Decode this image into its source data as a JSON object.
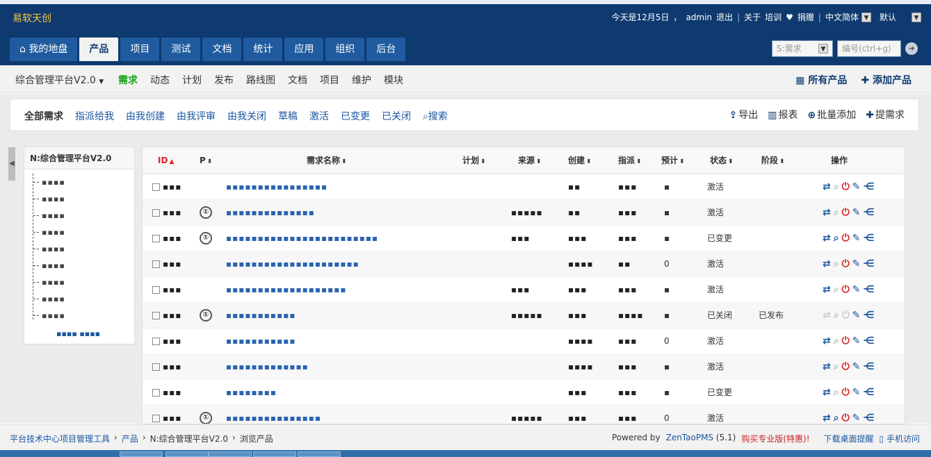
{
  "app": {
    "brand": "易软天创"
  },
  "topbar": {
    "date": "今天是12月5日",
    "user": "admin",
    "logout": "退出",
    "about": "关于",
    "training": "培训",
    "donate": "捐赠",
    "language": "中文简体",
    "theme": "默认"
  },
  "mainnav": [
    "我的地盘",
    "产品",
    "项目",
    "测试",
    "文档",
    "统计",
    "应用",
    "组织",
    "后台"
  ],
  "search": {
    "type": "S:需求",
    "placeholder": "编号(ctrl+g)"
  },
  "subnav": {
    "product": "综合管理平台V2.0",
    "items": [
      "需求",
      "动态",
      "计划",
      "发布",
      "路线图",
      "文档",
      "项目",
      "维护",
      "模块"
    ],
    "all_products": "所有产品",
    "add_product": "添加产品"
  },
  "featurebar": {
    "tabs": [
      "全部需求",
      "指派给我",
      "由我创建",
      "由我评审",
      "由我关闭",
      "草稿",
      "激活",
      "已变更",
      "已关闭",
      "搜索"
    ],
    "export": "导出",
    "report": "报表",
    "batch_add": "批量添加",
    "create": "提需求"
  },
  "tree": {
    "title": "N:综合管理平台V2.0",
    "nodes": [
      "▪▪▪▪",
      "▪▪▪▪",
      "▪▪▪▪",
      "▪▪▪▪",
      "▪▪▪▪",
      "▪▪▪▪",
      "▪▪▪▪",
      "▪▪▪▪",
      "▪▪▪▪"
    ],
    "manage": "▪▪▪▪ ▪▪▪▪"
  },
  "table": {
    "headers": [
      "ID",
      "P",
      "需求名称",
      "计划",
      "来源",
      "创建",
      "指派",
      "预计",
      "状态",
      "阶段",
      "操作"
    ],
    "rows": [
      {
        "id": "▪▪▪",
        "pri": "",
        "title": "▪▪▪▪▪▪▪▪▪▪▪▪▪▪▪▪",
        "source": "",
        "creator": "▪▪",
        "assigned": "▪▪▪",
        "estimate": "▪",
        "status": "激活",
        "stage": ""
      },
      {
        "id": "▪▪▪",
        "pri": "①",
        "title": "▪▪▪▪▪▪▪▪▪▪▪▪▪▪",
        "source": "▪▪▪▪▪",
        "creator": "▪▪",
        "assigned": "▪▪▪",
        "estimate": "▪",
        "status": "激活",
        "stage": ""
      },
      {
        "id": "▪▪▪",
        "pri": "①",
        "title": "▪▪▪▪▪▪▪▪▪▪▪▪▪▪▪▪▪▪▪▪▪▪▪▪",
        "source": "▪▪▪",
        "creator": "▪▪▪",
        "assigned": "▪▪▪",
        "estimate": "▪",
        "status": "已变更",
        "stage": ""
      },
      {
        "id": "▪▪▪",
        "pri": "",
        "title": "▪▪▪▪▪▪▪▪▪▪▪▪▪▪▪▪▪▪▪▪▪",
        "source": "",
        "creator": "▪▪▪▪",
        "assigned": "▪▪",
        "estimate": "0",
        "status": "激活",
        "stage": ""
      },
      {
        "id": "▪▪▪",
        "pri": "",
        "title": "▪▪▪▪▪▪▪▪▪▪▪▪▪▪▪▪▪▪▪",
        "source": "▪▪▪",
        "creator": "▪▪▪",
        "assigned": "▪▪▪",
        "estimate": "▪",
        "status": "激活",
        "stage": ""
      },
      {
        "id": "▪▪▪",
        "pri": "①",
        "title": "▪▪▪▪▪▪▪▪▪▪▪",
        "source": "▪▪▪▪▪",
        "creator": "▪▪▪",
        "assigned": "▪▪▪▪",
        "estimate": "▪",
        "status": "已关闭",
        "stage": "已发布"
      },
      {
        "id": "▪▪▪",
        "pri": "",
        "title": "▪▪▪▪▪▪▪▪▪▪▪",
        "source": "",
        "creator": "▪▪▪▪",
        "assigned": "▪▪▪",
        "estimate": "0",
        "status": "激活",
        "stage": ""
      },
      {
        "id": "▪▪▪",
        "pri": "",
        "title": "▪▪▪▪▪▪▪▪▪▪▪▪▪",
        "source": "",
        "creator": "▪▪▪▪",
        "assigned": "▪▪▪",
        "estimate": "▪",
        "status": "激活",
        "stage": ""
      },
      {
        "id": "▪▪▪",
        "pri": "",
        "title": "▪▪▪▪▪▪▪▪",
        "source": "",
        "creator": "▪▪▪",
        "assigned": "▪▪▪",
        "estimate": "▪",
        "status": "已变更",
        "stage": ""
      },
      {
        "id": "▪▪▪",
        "pri": "①",
        "title": "▪▪▪▪▪▪▪▪▪▪▪▪▪▪▪",
        "source": "▪▪▪▪▪",
        "creator": "▪▪▪",
        "assigned": "▪▪▪",
        "estimate": "0",
        "status": "激活",
        "stage": ""
      }
    ]
  },
  "footer": {
    "crumbs": [
      "平台技术中心项目管理工具",
      "产品",
      "N:综合管理平台V2.0",
      "浏览产品"
    ],
    "powered": "Powered by",
    "zentao": "ZenTaoPMS",
    "version": "(5.1)",
    "buy": "购买专业版(特惠)!",
    "download": "下载桌面提醒",
    "mobile": "手机访问"
  },
  "colors": {
    "header": "#0e3a6f",
    "tab": "#1f5b9e",
    "brand": "#f5c842",
    "link": "#1a56a0",
    "accent_green": "#16a316",
    "danger": "#dd2222"
  }
}
